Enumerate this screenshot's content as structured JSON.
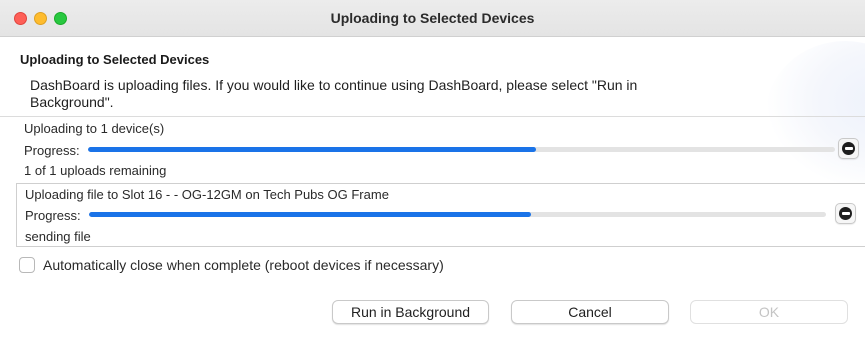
{
  "window": {
    "title": "Uploading to Selected Devices"
  },
  "header": {
    "title": "Uploading to Selected Devices",
    "message": "DashBoard is uploading files.  If you would like to continue using DashBoard, please select \"Run in Background\"."
  },
  "overall": {
    "device_label": "Uploading to 1 device(s)",
    "progress_label": "Progress:",
    "progress_fraction": 0.6,
    "remaining_label": "1 of 1 uploads remaining"
  },
  "file": {
    "label": "Uploading file to Slot 16 -  - OG-12GM on Tech Pubs OG Frame",
    "progress_label": "Progress:",
    "progress_fraction": 0.6,
    "status": "sending file"
  },
  "options": {
    "auto_close_label": "Automatically close when complete (reboot devices if necessary)",
    "auto_close_checked": false
  },
  "buttons": {
    "run_in_background": "Run in Background",
    "cancel": "Cancel",
    "ok": "OK"
  },
  "colors": {
    "progress_fill": "#1a73e8",
    "progress_track": "#e3e3e3"
  },
  "icons": {
    "stop": "stop-circle-icon"
  }
}
